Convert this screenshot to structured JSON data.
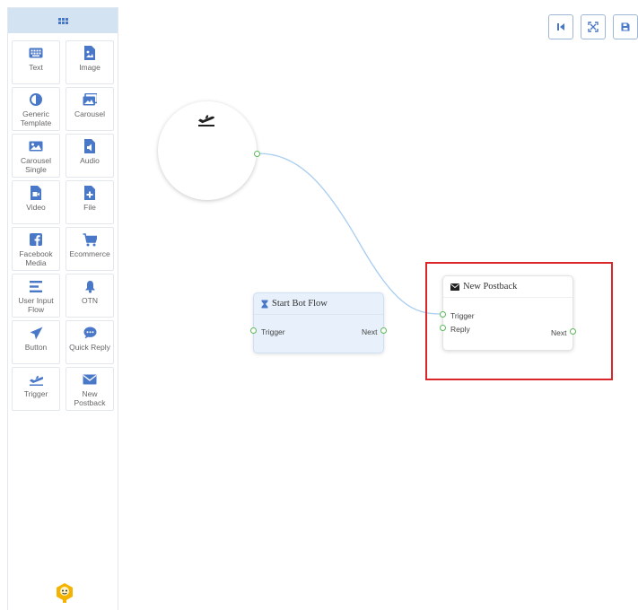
{
  "sidebar": {
    "items": [
      {
        "label": "Text",
        "icon": "keyboard-icon"
      },
      {
        "label": "Image",
        "icon": "image-file-icon"
      },
      {
        "label": "Generic\nTemplate",
        "icon": "half-circle-icon"
      },
      {
        "label": "Carousel",
        "icon": "gallery-icon"
      },
      {
        "label": "Carousel\nSingle",
        "icon": "picture-icon"
      },
      {
        "label": "Audio",
        "icon": "audio-file-icon"
      },
      {
        "label": "Video",
        "icon": "video-file-icon"
      },
      {
        "label": "File",
        "icon": "file-plus-icon"
      },
      {
        "label": "Facebook\nMedia",
        "icon": "facebook-icon"
      },
      {
        "label": "Ecommerce",
        "icon": "cart-icon"
      },
      {
        "label": "User Input\nFlow",
        "icon": "lines-icon"
      },
      {
        "label": "OTN",
        "icon": "bell-icon"
      },
      {
        "label": "Button",
        "icon": "send-icon"
      },
      {
        "label": "Quick Reply",
        "icon": "chat-icon"
      },
      {
        "label": "Trigger",
        "icon": "plane-takeoff-icon"
      },
      {
        "label": "New\nPostback",
        "icon": "envelope-icon"
      }
    ]
  },
  "toolbar": {
    "buttons": [
      "first-page-icon",
      "fit-view-icon",
      "save-icon"
    ]
  },
  "nodes": {
    "start_node": {
      "title": "Start Bot Flow",
      "input": "Trigger",
      "output": "Next"
    },
    "postback_node": {
      "title": "New Postback",
      "input1": "Trigger",
      "input2": "Reply",
      "output": "Next"
    }
  },
  "colors": {
    "accent": "#4a78c8",
    "port": "#5cb85c",
    "wire": "#a9cdf0",
    "highlight": "#d9262b"
  }
}
